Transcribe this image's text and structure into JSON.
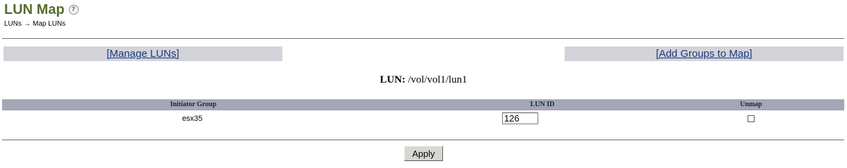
{
  "page": {
    "title": "LUN Map",
    "help_icon": "help-icon"
  },
  "breadcrumb": {
    "items": [
      "LUNs",
      "Map LUNs"
    ],
    "separator": "→"
  },
  "links": {
    "manage": "[Manage LUNs]",
    "add_groups": "[Add Groups to Map]"
  },
  "lun": {
    "label": "LUN:",
    "path": "/vol/vol1/lun1"
  },
  "table": {
    "headers": [
      "Initiator Group",
      "LUN ID",
      "Unmap"
    ],
    "rows": [
      {
        "initiator_group": "esx35",
        "lun_id": "126",
        "unmap": false
      }
    ]
  },
  "actions": {
    "apply": "Apply"
  },
  "colors": {
    "title": "#556b2f",
    "link_bar_bg": "#d3d3da",
    "table_header_bg": "#a4a6b6"
  }
}
